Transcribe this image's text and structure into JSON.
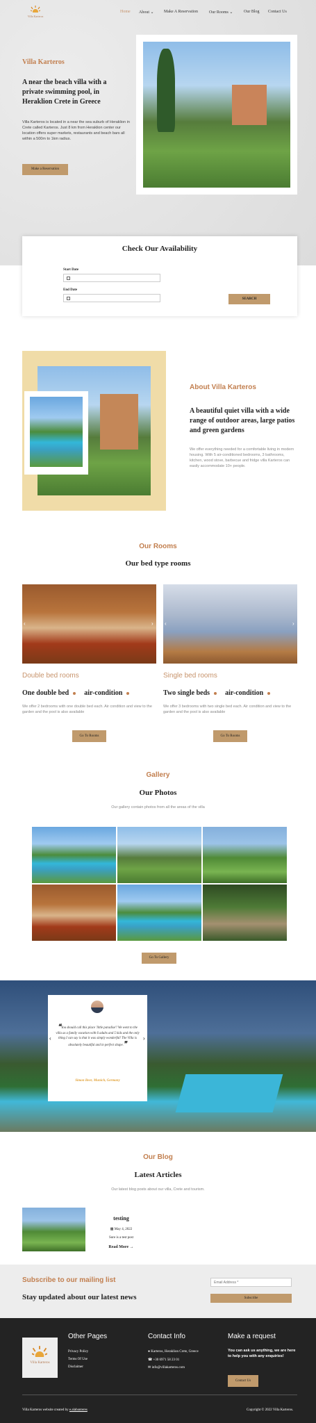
{
  "logo": {
    "text": "Villa Karteros"
  },
  "nav": {
    "items": [
      {
        "label": "Home",
        "active": true
      },
      {
        "label": "About",
        "dropdown": true
      },
      {
        "label": "Make A Reservation"
      },
      {
        "label": "Our Rooms",
        "dropdown": true
      },
      {
        "label": "Our Blog"
      },
      {
        "label": "Contact Us"
      }
    ]
  },
  "hero": {
    "brand": "Villa Karteros",
    "title": "A near the beach villa with a private swimming pool, in Heraklion Crete in Greece",
    "text": "Villa Karteros is located in a near the sea suburb of Heraklion in Crete called Karteros. Just 8 km from Heraklion center our location offers super markets, restaurants and beach bars all within a 500m to 1km radius.",
    "button": "Make a Reservation"
  },
  "availability": {
    "title": "Check Our Availability",
    "start_label": "Start Date",
    "end_label": "End Date",
    "search_button": "SEARCH"
  },
  "about": {
    "small_title": "About Villa Karteros",
    "title": "A beautiful quiet villa with a wide range of outdoor areas, large patios and green gardens",
    "text": "We offer everything needed for a comfortable living in modern housing. With 5 air-conditioned bedrooms, 3 bathrooms, kitchen, wood stove, barbecue and fridge villa Karteros can easily accommodate 10+ people."
  },
  "rooms": {
    "small_title": "Our Rooms",
    "title": "Our bed type rooms",
    "cards": [
      {
        "heading": "Double bed rooms",
        "title_a": "One double bed",
        "title_b": "air-condition",
        "text": "We offer 2 bedrooms with one double bed each. Air condition and view to the garden and the pool is also available",
        "button": "Go To Rooms"
      },
      {
        "heading": "Single bed rooms",
        "title_a": "Two single beds",
        "title_b": "air-condition",
        "text": "We offer 3 bedrooms with two single bed each. Air condition and view to the garden and the pool is also available",
        "button": "Go To Rooms"
      }
    ]
  },
  "gallery": {
    "small_title": "Gallery",
    "title": "Our Photos",
    "subtitle": "Our gallery contain photos from all the areas of the villa",
    "button": "Go To Gallery"
  },
  "testimonial": {
    "quote": "You should call this place 'little paradise'! We went to the villa as a family vacation with 6 adults and 5 kids and the only thing I can say is that it was simply wonderful! The Villa is absolutely beautiful and in perfect shape.",
    "author": "Simon Beer, Munich, Germany"
  },
  "blog": {
    "small_title": "Our Blog",
    "title": "Latest Articles",
    "subtitle": "Our latest blog posts about our villa, Crete and tourism.",
    "post": {
      "title": "testing",
      "date": "May 4, 2022",
      "excerpt": "Sure is a test post",
      "read_more": "Read More"
    }
  },
  "mailing": {
    "small_title": "Subscribe to our mailing list",
    "title": "Stay updated about our latest news",
    "placeholder": "Email Address *",
    "button": "Subscribe"
  },
  "footer": {
    "logo_text": "Villa Karteros",
    "pages_title": "Other Pages",
    "pages": [
      "Privacy Policy",
      "Terms Of Use",
      "Disclaimer"
    ],
    "contact_title": "Contact Info",
    "contact": [
      "Karteros, Heraklion Crete, Greece",
      "+30 6971 58 23 01",
      "info@villakarteros.com"
    ],
    "request_title": "Make a request",
    "request_text": "You can ask us anything, we are here to help you with any enquiries!",
    "request_button": "Contact Us",
    "credit_prefix": "Villa Karteros website created by",
    "credit_link": "e.alabanteres",
    "copyright": "Copyright © 2022 Villa Karteros."
  },
  "colors": {
    "accent": "#c27f4f",
    "button": "#c09a6c",
    "footer_bg": "#232323"
  }
}
